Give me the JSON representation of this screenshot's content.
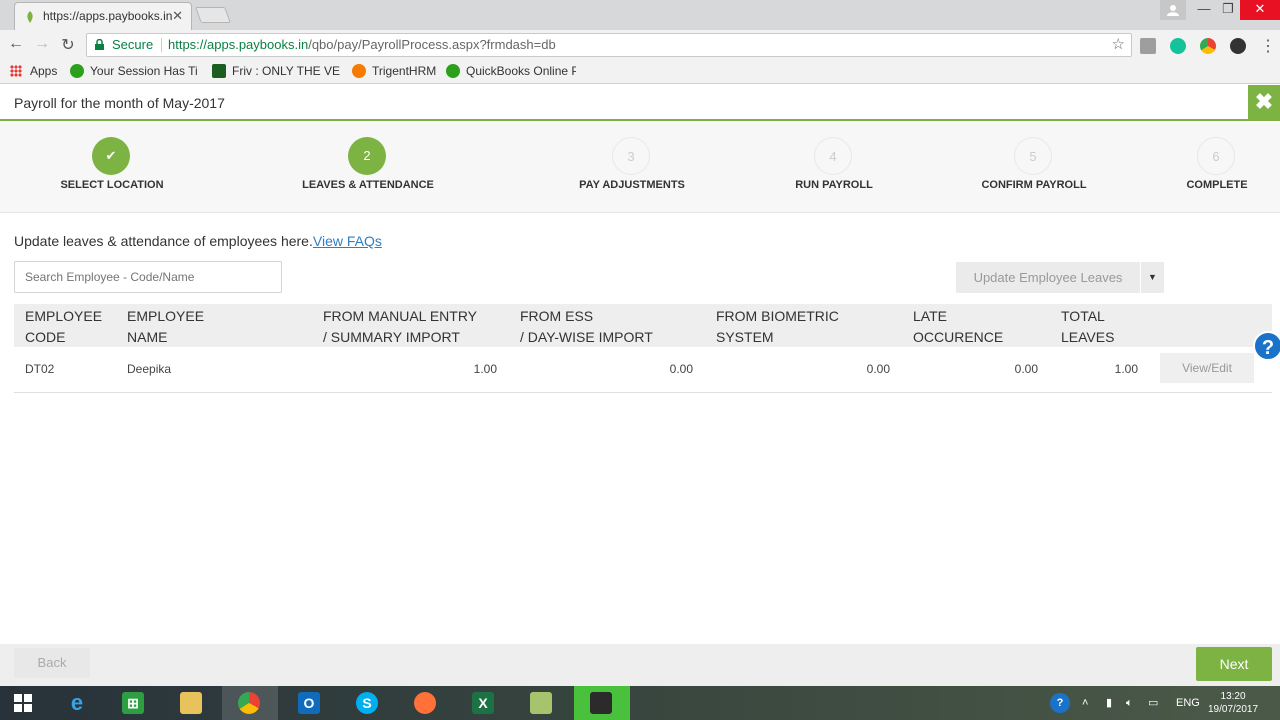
{
  "browser": {
    "tab_title": "https://apps.paybooks.in",
    "tab_close": "✕",
    "secure_label": "Secure",
    "url_host": "https://apps.paybooks.in",
    "url_path": "/qbo/pay/PayrollProcess.aspx?frmdash=db",
    "bookmarks": [
      "Apps",
      "Your Session Has Tim",
      "Friv : ONLY THE VERY",
      "TrigentHRM",
      "QuickBooks Online P"
    ]
  },
  "header": {
    "title": "Payroll for the month of May-2017",
    "close_glyph": "✖"
  },
  "steps": [
    {
      "number": "✔",
      "label": "SELECT LOCATION",
      "state": "done"
    },
    {
      "number": "2",
      "label": "LEAVES & ATTENDANCE",
      "state": "active"
    },
    {
      "number": "3",
      "label": "PAY ADJUSTMENTS",
      "state": "todo"
    },
    {
      "number": "4",
      "label": "RUN PAYROLL",
      "state": "todo"
    },
    {
      "number": "5",
      "label": "CONFIRM PAYROLL",
      "state": "todo"
    },
    {
      "number": "6",
      "label": "COMPLETE",
      "state": "todo"
    }
  ],
  "content": {
    "intro_text": "Update leaves & attendance of employees here.",
    "faq_link": "View FAQs",
    "search_placeholder": "Search Employee - Code/Name",
    "update_button": "Update Employee Leaves",
    "update_caret": "▼"
  },
  "table": {
    "headers": [
      "EMPLOYEE\nCODE",
      "EMPLOYEE\nNAME",
      "FROM MANUAL ENTRY\n/ SUMMARY IMPORT",
      "FROM ESS\n/ DAY-WISE IMPORT",
      "FROM BIOMETRIC\nSYSTEM",
      "LATE\nOCCURENCE",
      "TOTAL\nLEAVES"
    ],
    "rows": [
      {
        "code": "DT02",
        "name": "Deepika",
        "manual": "1.00",
        "ess": "0.00",
        "biometric": "0.00",
        "late": "0.00",
        "total": "1.00",
        "action": "View/Edit"
      }
    ]
  },
  "footer": {
    "back": "Back",
    "next": "Next"
  },
  "help_glyph": "?",
  "tray": {
    "lang": "ENG",
    "time": "13:20",
    "date": "19/07/2017"
  },
  "colors": {
    "accent": "#7cb342",
    "link": "#2d7fc1",
    "secure": "#0b8043"
  }
}
